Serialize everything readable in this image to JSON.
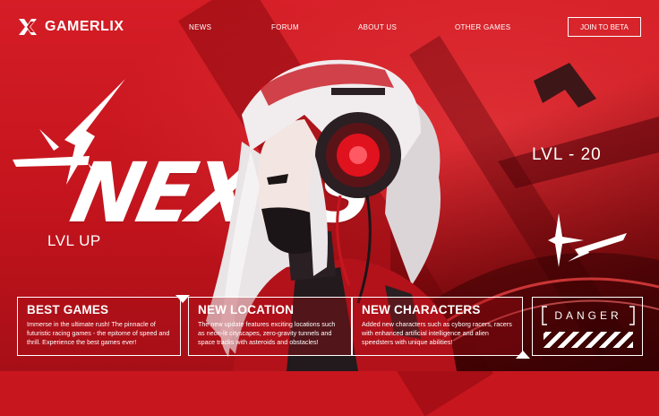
{
  "brand": {
    "name": "GAMERLIX"
  },
  "nav": {
    "items": [
      "NEWS",
      "FORUM",
      "ABOUT US",
      "OTHER GAMES"
    ]
  },
  "cta": {
    "label": "JOIN TO BETA"
  },
  "hero": {
    "title": "NEXUS",
    "tag_left": "LVL UP",
    "tag_right": "LVL - 20"
  },
  "cards": [
    {
      "title": "BEST GAMES",
      "body": "Immerse in the ultimate rush! The pinnacle of futuristic racing games - the epitome of speed and thrill. Experience the best games ever!"
    },
    {
      "title": "NEW LOCATION",
      "body": "The new update features exciting locations such as neon-lit cityscapes, zero-gravity tunnels and space tracks with asteroids and obstacles!"
    },
    {
      "title": "NEW CHARACTERS",
      "body": "Added new characters such as cyborg racers, racers with enhanced artificial intelligence and alien speedsters with unique abilities!"
    }
  ],
  "danger": {
    "label": "DANGER"
  },
  "colors": {
    "accent": "#d51d26",
    "dark": "#1a1416",
    "white": "#ffffff"
  },
  "icons": [
    "gamerlix-logo-icon",
    "arrow-burst-icon",
    "star-spark-icon",
    "hazard-stripes-icon"
  ]
}
